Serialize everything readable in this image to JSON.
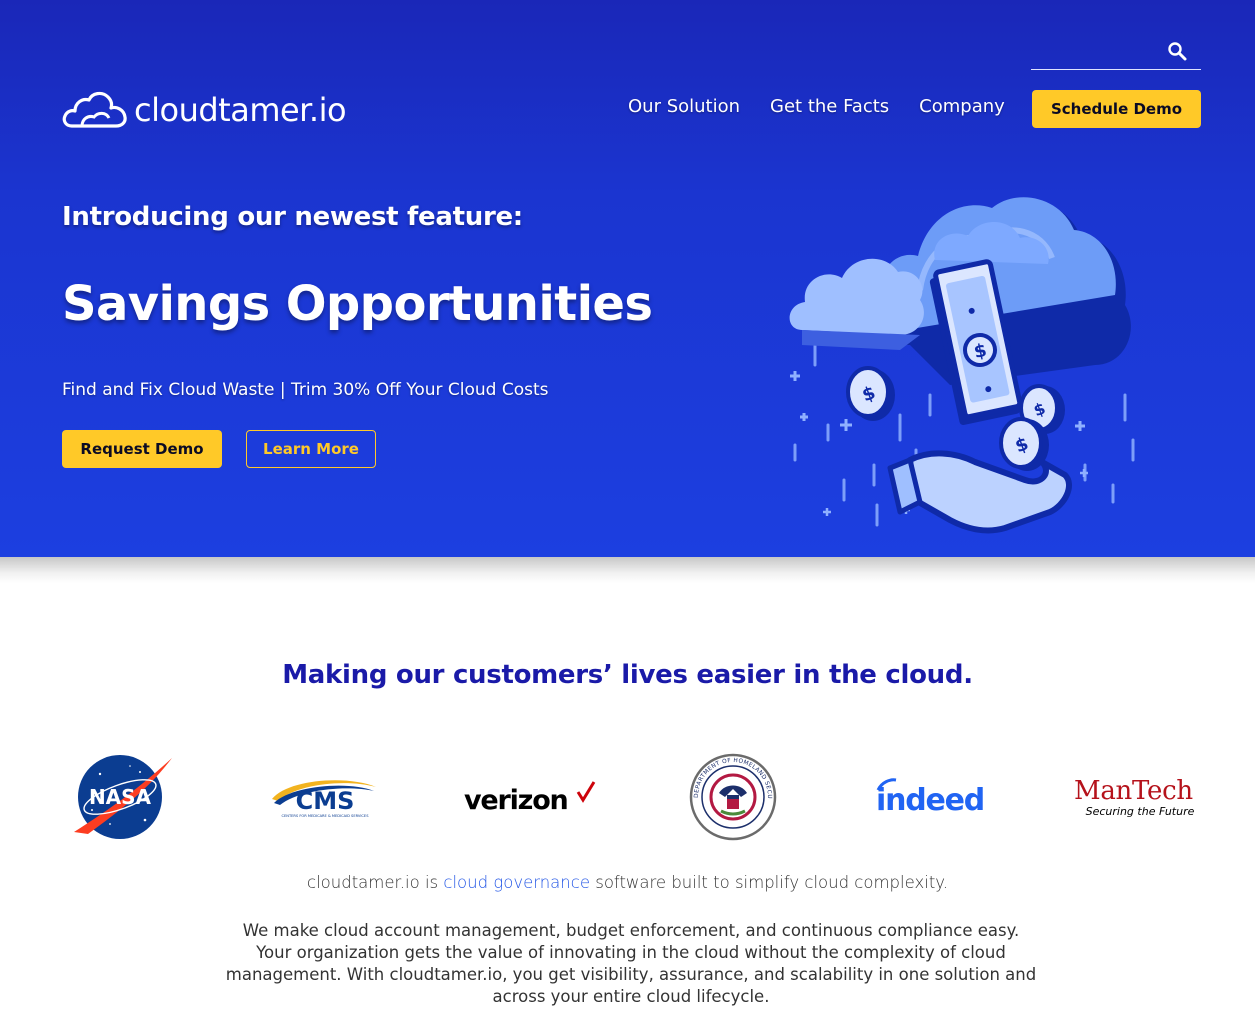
{
  "brand": {
    "logo_text": "cloudtamer.io"
  },
  "search": {
    "placeholder": "",
    "value": ""
  },
  "nav": {
    "items": [
      "Our Solution",
      "Get the Facts",
      "Company"
    ],
    "cta": "Schedule Demo"
  },
  "hero": {
    "kicker": "Introducing our newest feature:",
    "title": "Savings Opportunities",
    "subtitle": "Find and Fix Cloud Waste | Trim 30% Off Your Cloud Costs",
    "primary_button": "Request Demo",
    "secondary_button": "Learn More"
  },
  "customers": {
    "title": "Making our customers’ lives easier in the cloud.",
    "logos": [
      {
        "name": "NASA",
        "icon": "nasa-logo"
      },
      {
        "name": "CMS",
        "icon": "cms-logo",
        "tagline": "CENTERS FOR MEDICARE & MEDICAID SERVICES"
      },
      {
        "name": "verizon",
        "icon": "verizon-logo"
      },
      {
        "name": "U.S. DEPARTMENT OF HOMELAND SECURITY",
        "icon": "dhs-seal"
      },
      {
        "name": "indeed",
        "icon": "indeed-logo"
      },
      {
        "name": "ManTech",
        "icon": "mantech-logo",
        "tagline": "Securing the Future"
      }
    ]
  },
  "about": {
    "lead_prefix": "cloudtamer.io is ",
    "lead_link": "cloud governance",
    "lead_suffix": " software built to simplify cloud complexity.",
    "paragraph": "We make cloud account management, budget enforcement, and continuous compliance easy. Your organization gets the value of innovating in the cloud without the complexity of cloud management. With cloudtamer.io, you get visibility, assurance, and scalability in one solution and across your entire cloud lifecycle."
  },
  "colors": {
    "hero_bg": "#1c3fe0",
    "accent_yellow": "#ffc928",
    "heading_blue": "#1a1aa8",
    "link_blue": "#2457e6"
  }
}
